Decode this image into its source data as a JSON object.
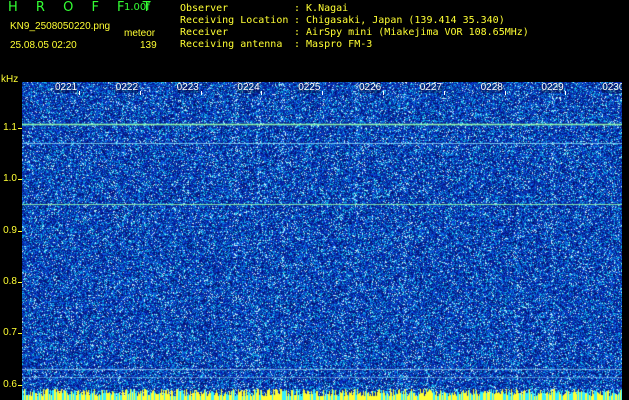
{
  "header": {
    "app_title": "H R O F F T",
    "app_version": "1.00f",
    "file_name": "KN9_2508050220.png",
    "meteor_label": "meteor",
    "meteor_count": "139",
    "timestamp": "25.08.05 02:20"
  },
  "info": [
    {
      "key": "Observer",
      "value": ": K.Nagai"
    },
    {
      "key": "Receiving Location",
      "value": ": Chigasaki, Japan (139.414 35.340)"
    },
    {
      "key": "Receiver",
      "value": ": AirSpy mini (Miakejima VOR 108.65MHz)"
    },
    {
      "key": "Receiving antenna",
      "value": ": Maspro FM-3"
    }
  ],
  "axis": {
    "unit": "kHz",
    "y_ticks": [
      "1.1",
      "1.0",
      "0.9",
      "0.8",
      "0.7",
      "0.6"
    ],
    "y_tick_values": [
      1.1,
      1.0,
      0.9,
      0.8,
      0.7,
      0.6
    ],
    "y_range": [
      0.57,
      1.19
    ]
  },
  "time_labels": [
    "0221",
    "0222",
    "0223",
    "0224",
    "0225",
    "0226",
    "0227",
    "0228",
    "0229",
    "0230"
  ],
  "colors": {
    "text": "#ffff33",
    "title": "#33ff33",
    "background": "#0a1b86",
    "signal_lines": "#7fff9f"
  }
}
